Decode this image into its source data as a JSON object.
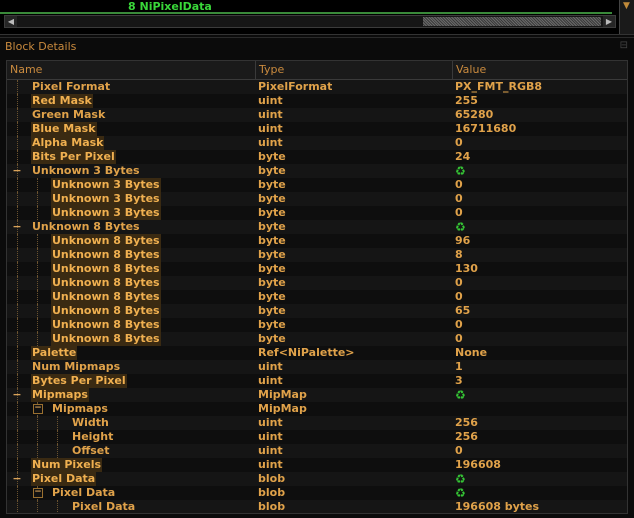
{
  "block_list": {
    "selected_label": "8 NiPixelData"
  },
  "details": {
    "title": "Block Details",
    "columns": {
      "name": "Name",
      "type": "Type",
      "value": "Value"
    },
    "rows": [
      {
        "name": "Pixel Format",
        "type": "PixelFormat",
        "value": "PX_FMT_RGB8",
        "depth": 0,
        "expander": ""
      },
      {
        "name": "Red Mask",
        "type": "uint",
        "value": "255",
        "depth": 0,
        "expander": ""
      },
      {
        "name": "Green Mask",
        "type": "uint",
        "value": "65280",
        "depth": 0,
        "expander": ""
      },
      {
        "name": "Blue Mask",
        "type": "uint",
        "value": "16711680",
        "depth": 0,
        "expander": ""
      },
      {
        "name": "Alpha Mask",
        "type": "uint",
        "value": "0",
        "depth": 0,
        "expander": ""
      },
      {
        "name": "Bits Per Pixel",
        "type": "byte",
        "value": "24",
        "depth": 0,
        "expander": ""
      },
      {
        "name": "Unknown 3 Bytes",
        "type": "byte",
        "value": "",
        "value_icon": "refresh-icon",
        "depth": 0,
        "expander": "−"
      },
      {
        "name": "Unknown 3 Bytes",
        "type": "byte",
        "value": "0",
        "depth": 1,
        "expander": ""
      },
      {
        "name": "Unknown 3 Bytes",
        "type": "byte",
        "value": "0",
        "depth": 1,
        "expander": ""
      },
      {
        "name": "Unknown 3 Bytes",
        "type": "byte",
        "value": "0",
        "depth": 1,
        "expander": ""
      },
      {
        "name": "Unknown 8 Bytes",
        "type": "byte",
        "value": "",
        "value_icon": "refresh-icon",
        "depth": 0,
        "expander": "−"
      },
      {
        "name": "Unknown 8 Bytes",
        "type": "byte",
        "value": "96",
        "depth": 1,
        "expander": ""
      },
      {
        "name": "Unknown 8 Bytes",
        "type": "byte",
        "value": "8",
        "depth": 1,
        "expander": ""
      },
      {
        "name": "Unknown 8 Bytes",
        "type": "byte",
        "value": "130",
        "depth": 1,
        "expander": ""
      },
      {
        "name": "Unknown 8 Bytes",
        "type": "byte",
        "value": "0",
        "depth": 1,
        "expander": ""
      },
      {
        "name": "Unknown 8 Bytes",
        "type": "byte",
        "value": "0",
        "depth": 1,
        "expander": ""
      },
      {
        "name": "Unknown 8 Bytes",
        "type": "byte",
        "value": "65",
        "depth": 1,
        "expander": ""
      },
      {
        "name": "Unknown 8 Bytes",
        "type": "byte",
        "value": "0",
        "depth": 1,
        "expander": ""
      },
      {
        "name": "Unknown 8 Bytes",
        "type": "byte",
        "value": "0",
        "depth": 1,
        "expander": ""
      },
      {
        "name": "Palette",
        "type": "Ref<NiPalette>",
        "value": "None",
        "depth": 0,
        "expander": ""
      },
      {
        "name": "Num Mipmaps",
        "type": "uint",
        "value": "1",
        "depth": 0,
        "expander": ""
      },
      {
        "name": "Bytes Per Pixel",
        "type": "uint",
        "value": "3",
        "depth": 0,
        "expander": ""
      },
      {
        "name": "Mipmaps",
        "type": "MipMap",
        "value": "",
        "value_icon": "refresh-icon",
        "depth": 0,
        "expander": "−"
      },
      {
        "name": "Mipmaps",
        "type": "MipMap",
        "value": "",
        "depth": 1,
        "expander": "−"
      },
      {
        "name": "Width",
        "type": "uint",
        "value": "256",
        "depth": 2,
        "expander": ""
      },
      {
        "name": "Height",
        "type": "uint",
        "value": "256",
        "depth": 2,
        "expander": ""
      },
      {
        "name": "Offset",
        "type": "uint",
        "value": "0",
        "depth": 2,
        "expander": ""
      },
      {
        "name": "Num Pixels",
        "type": "uint",
        "value": "196608",
        "depth": 0,
        "expander": ""
      },
      {
        "name": "Pixel Data",
        "type": "blob",
        "value": "",
        "value_icon": "refresh-icon",
        "depth": 0,
        "expander": "−"
      },
      {
        "name": "Pixel Data",
        "type": "blob",
        "value": "",
        "value_icon": "refresh-icon",
        "depth": 1,
        "expander": "−"
      },
      {
        "name": "Pixel Data",
        "type": "blob",
        "value": "196608 bytes",
        "depth": 2,
        "expander": ""
      }
    ]
  },
  "colors": {
    "text": "#e0a24a",
    "accent_green": "#39d739",
    "background": "#151515"
  }
}
